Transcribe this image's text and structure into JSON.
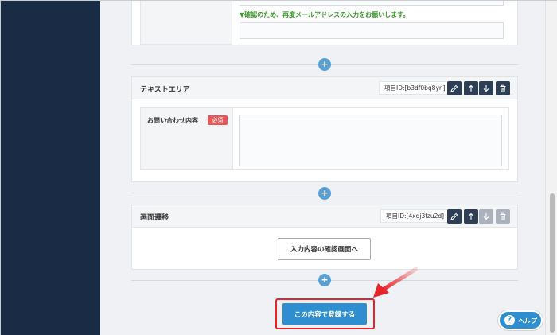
{
  "top_form": {
    "confirm_note": "▼確認のため、再度メールアドレスの入力をお願いします。"
  },
  "textarea_block": {
    "title": "テキストエリア",
    "item_id": "項目ID:[b3df0bq8yn]",
    "field_label": "お問い合わせ内容",
    "required_badge": "必須"
  },
  "transition_block": {
    "title": "画面遷移",
    "item_id": "項目ID:[4xdj3fzu2d]",
    "confirm_button_label": "入力内容の確認画面へ"
  },
  "add_button_glyph": "+",
  "submit_button_label": "この内容で登録する",
  "help_button": {
    "glyph": "?",
    "label": "ヘルプ"
  },
  "colors": {
    "sidebar": "#1a2b45",
    "accent_blue": "#2f8ed0",
    "highlight_red": "#e8232a",
    "required_red": "#e45858"
  }
}
